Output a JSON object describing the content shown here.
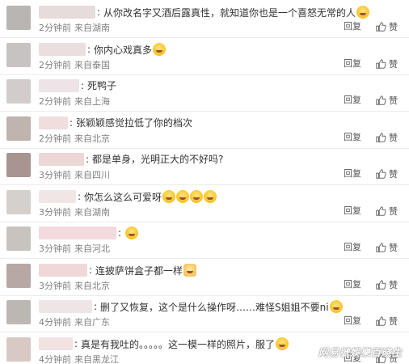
{
  "comments": [
    {
      "text": "从你改名字又酒后露真性，就知道你也是一个喜怒无常的人",
      "emoji": "laugh",
      "time": "2分钟前",
      "location": "来自湖南",
      "reply": "回复",
      "like": "赞",
      "avatar_color": "#b9b5b3",
      "name_color": "#e6dcdc"
    },
    {
      "text": "你内心戏真多",
      "emoji": "grin",
      "time": "2分钟前",
      "location": "来自泰国",
      "reply": "回复",
      "like": "赞",
      "avatar_color": "#c8c3c3",
      "name_color": "#eadede"
    },
    {
      "text": "死鸭子",
      "emoji": "",
      "time": "2分钟前",
      "location": "来自上海",
      "reply": "回复",
      "like": "赞",
      "avatar_color": "#d2cccc",
      "name_color": "#ece4e6"
    },
    {
      "text": "张颖颖感觉拉低了你的档次",
      "emoji": "",
      "time": "2分钟前",
      "location": "来自北京",
      "reply": "回复",
      "like": "赞",
      "avatar_color": "#bfb4ae",
      "name_color": "#f0dede"
    },
    {
      "text": "都是单身，光明正大的不好吗?",
      "emoji": "",
      "time": "3分钟前",
      "location": "来自四川",
      "reply": "回复",
      "like": "赞",
      "avatar_color": "#a89490",
      "name_color": "#ecd6d6"
    },
    {
      "text": "你怎么这么可爱呀",
      "emoji": "grin4",
      "time": "3分钟前",
      "location": "来自湖南",
      "reply": "回复",
      "like": "赞",
      "avatar_color": "#d6d0cc",
      "name_color": "#f0e6e6"
    },
    {
      "text": "",
      "emoji": "cry",
      "time": "3分钟前",
      "location": "来自河北",
      "reply": "回复",
      "like": "赞",
      "avatar_color": "#c9c3bf",
      "name_color": "#f2dadd"
    },
    {
      "text": "连披萨饼盒子都一样",
      "emoji": "cat",
      "time": "3分钟前",
      "location": "来自北京",
      "reply": "回复",
      "like": "赞",
      "avatar_color": "#b7a8a6",
      "name_color": "#f0d8d8"
    },
    {
      "text": "删了又恢复，这个是什么操作呀……难怪S姐姐不要ni",
      "emoji": "grin",
      "time": "4分钟前",
      "location": "来自广东",
      "reply": "回复",
      "like": "赞",
      "avatar_color": "#bdb7b4",
      "name_color": "#eee6e6"
    },
    {
      "text": "真是有我吐的。。。。。这一模一样的照片，服了",
      "emoji": "sweat",
      "time": "4分钟前",
      "location": "来自黑龙江",
      "reply": "回复",
      "like": "赞",
      "avatar_color": "#d8c9c4",
      "name_color": "#f2e2e2"
    }
  ],
  "watermark": "网易號娛樂百晓生"
}
